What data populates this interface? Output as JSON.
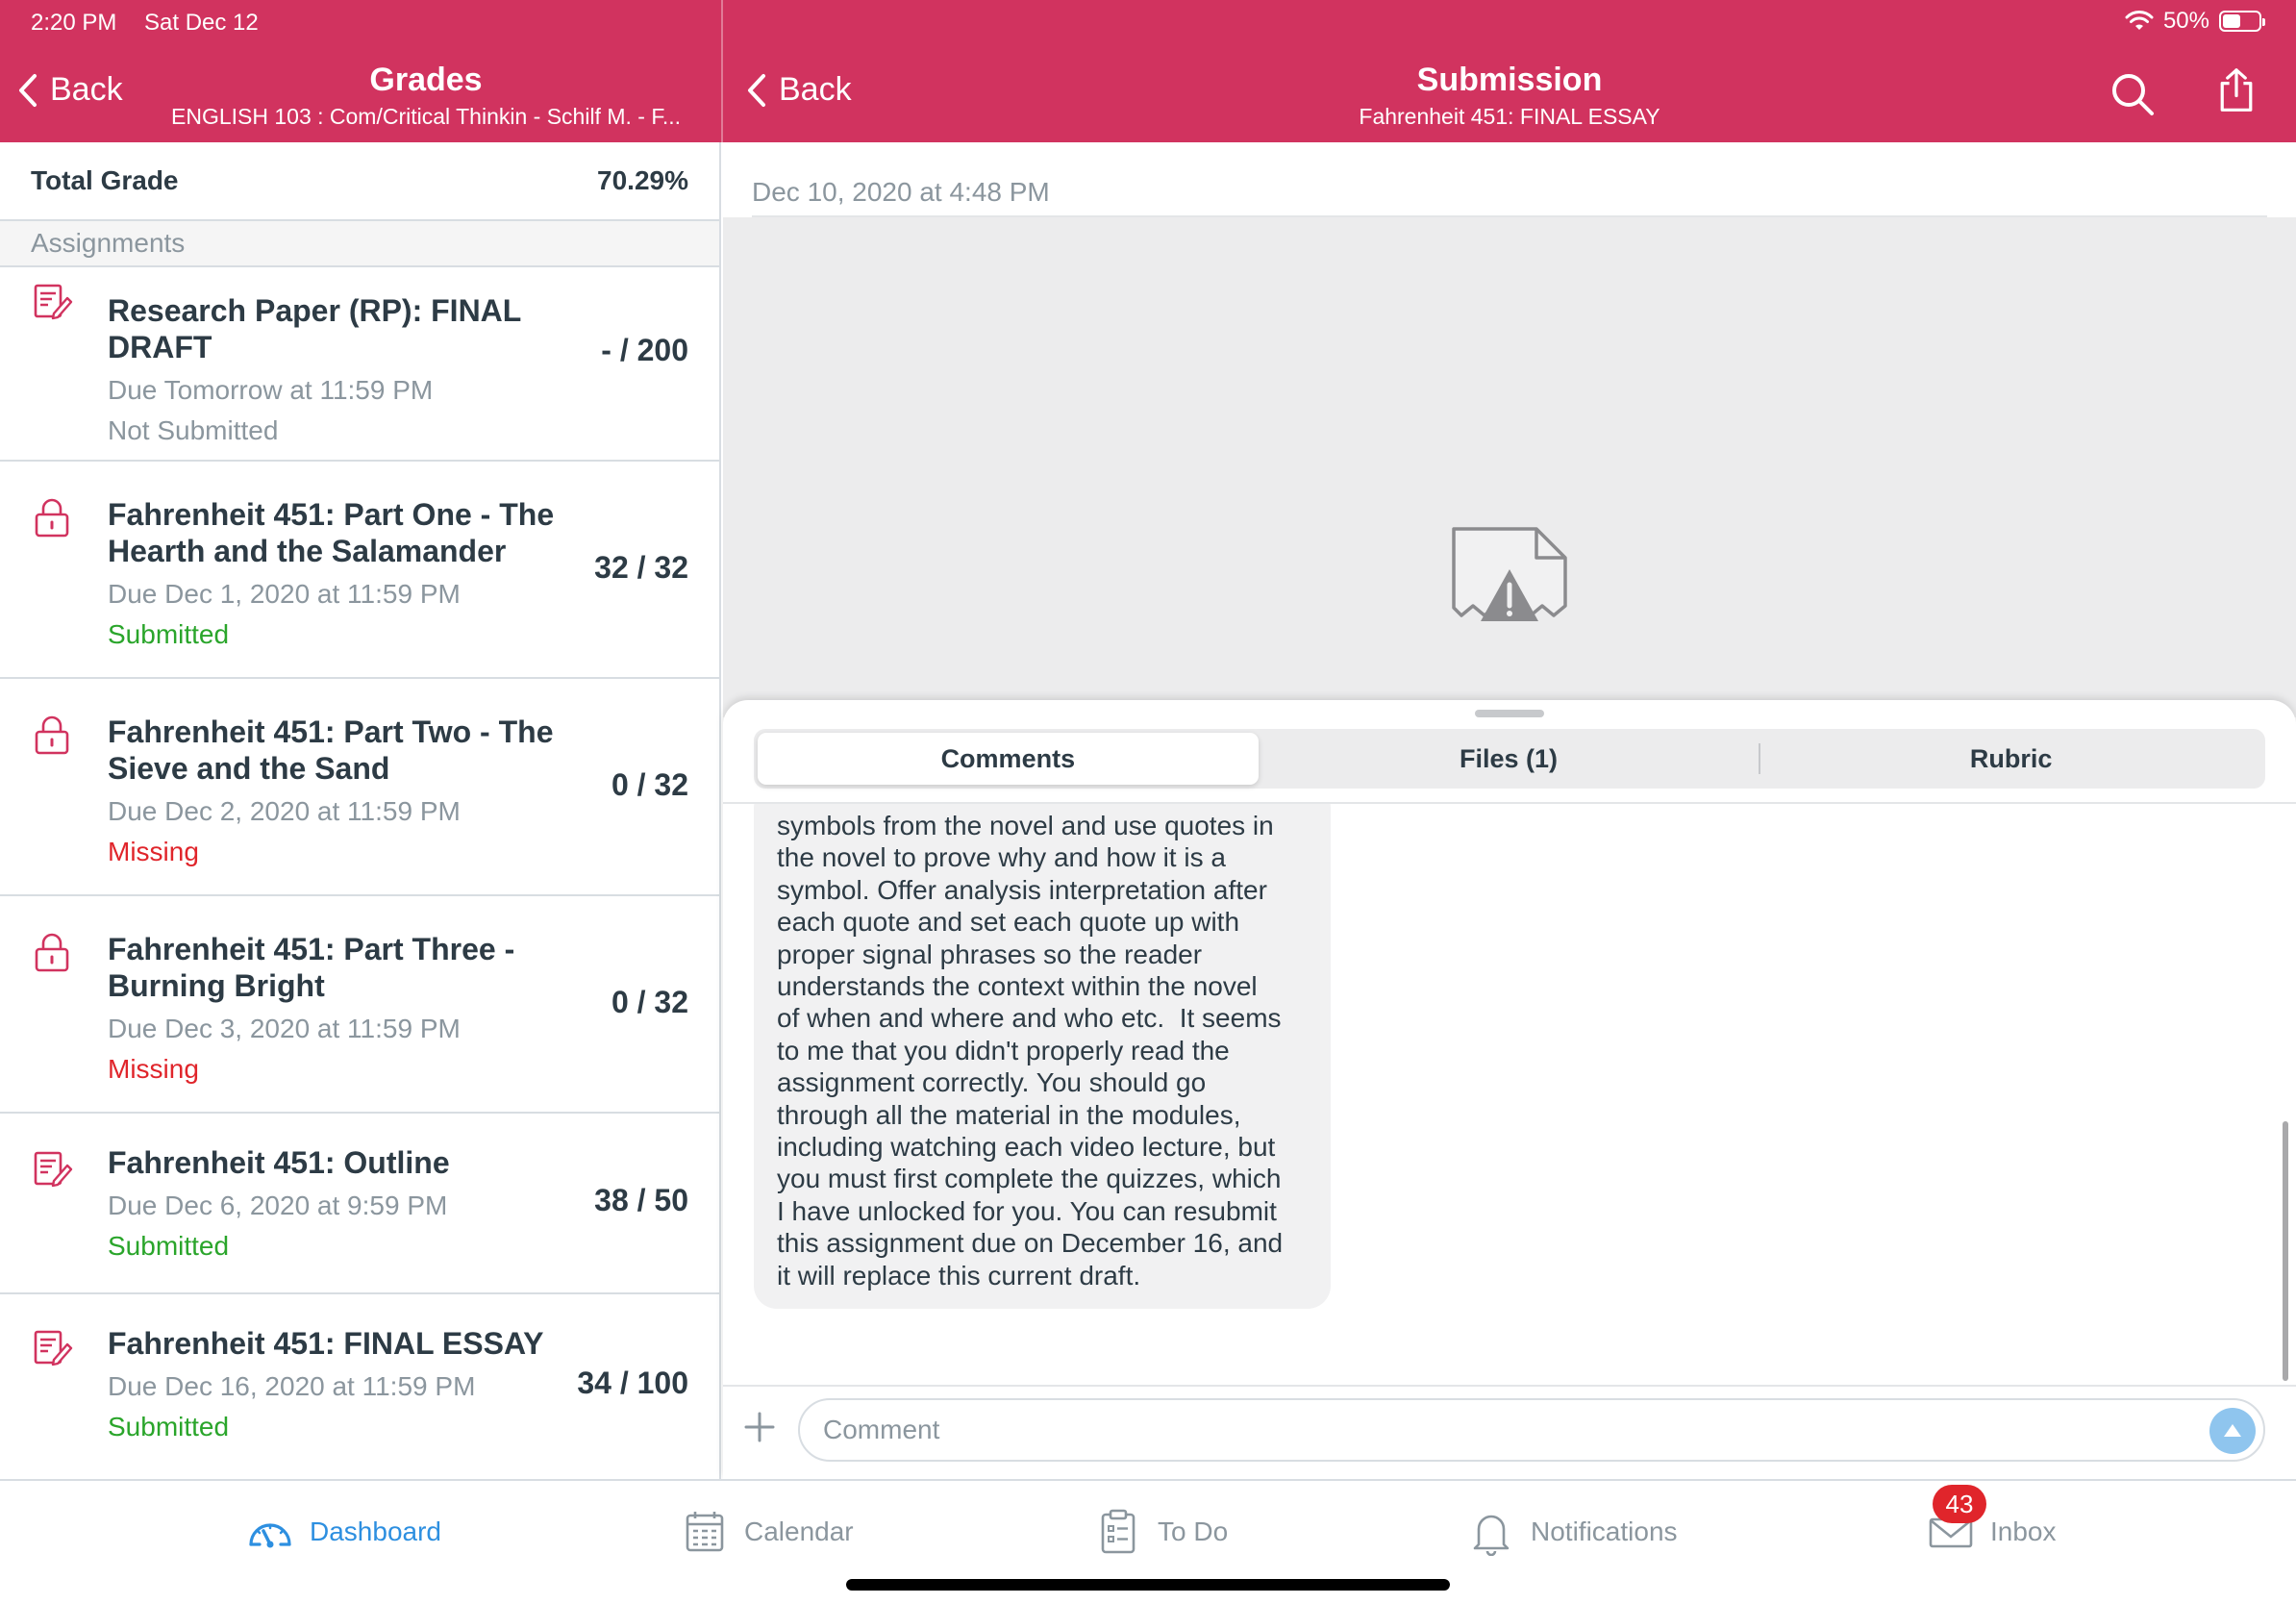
{
  "status": {
    "time": "2:20 PM",
    "date": "Sat Dec 12",
    "battery": "50%",
    "battery_level": 0.5
  },
  "left_header": {
    "back_label": "Back",
    "title": "Grades",
    "subtitle": "ENGLISH 103 : Com/Critical Thinkin - Schilf M. - F..."
  },
  "right_header": {
    "back_label": "Back",
    "title": "Submission",
    "subtitle": "Fahrenheit 451: FINAL ESSAY"
  },
  "grades": {
    "total_label": "Total Grade",
    "total_value": "70.29%",
    "section_label": "Assignments",
    "items": [
      {
        "name": "Research Paper (RP): FINAL DRAFT",
        "due": "Due Tomorrow at 11:59 PM",
        "status": "Not Submitted",
        "score": "- / 200",
        "icon": "assignment-icon",
        "status_color": "#8b969e"
      },
      {
        "name": "Fahrenheit 451: Part One - The Hearth and the Salamander",
        "due": "Due Dec 1, 2020 at 11:59 PM",
        "status": "Submitted",
        "score": "32 / 32",
        "icon": "lock-icon",
        "status_color": "#2aa52b"
      },
      {
        "name": "Fahrenheit 451: Part Two - The Sieve and the Sand",
        "due": "Due Dec 2, 2020 at 11:59 PM",
        "status": "Missing",
        "score": "0 / 32",
        "icon": "lock-icon",
        "status_color": "#e0252b"
      },
      {
        "name": "Fahrenheit 451: Part Three - Burning Bright",
        "due": "Due Dec 3, 2020 at 11:59 PM",
        "status": "Missing",
        "score": "0 / 32",
        "icon": "lock-icon",
        "status_color": "#e0252b"
      },
      {
        "name": "Fahrenheit 451: Outline",
        "due": "Due Dec 6, 2020 at 9:59 PM",
        "status": "Submitted",
        "score": "38 / 50",
        "icon": "assignment-icon",
        "status_color": "#2aa52b"
      },
      {
        "name": "Fahrenheit 451: FINAL ESSAY",
        "due": "Due Dec 16, 2020 at 11:59 PM",
        "status": "Submitted",
        "score": "34 / 100",
        "icon": "assignment-icon",
        "status_color": "#2aa52b"
      }
    ]
  },
  "submission": {
    "date": "Dec 10, 2020 at 4:48 PM",
    "tabs": [
      {
        "label": "Comments",
        "active": true
      },
      {
        "label": "Files (1)",
        "active": false
      },
      {
        "label": "Rubric",
        "active": false
      }
    ],
    "comment_text": "symbols from the novel and use quotes in\nthe novel to prove why and how it is a\nsymbol. Offer analysis interpretation after\neach quote and set each quote up with\nproper signal phrases so the reader\nunderstands the context within the novel\nof when and where and who etc.  It seems\nto me that you didn't properly read the\nassignment correctly. You should go\nthrough all the material in the modules,\nincluding watching each video lecture, but\nyou must first complete the quizzes, which\nI have unlocked for you. You can resubmit\nthis assignment due on December 16, and\nit will replace this current draft.",
    "comment_placeholder": "Comment"
  },
  "tabbar": {
    "items": [
      {
        "label": "Dashboard",
        "icon": "dashboard-icon",
        "active": true
      },
      {
        "label": "Calendar",
        "icon": "calendar-icon",
        "active": false
      },
      {
        "label": "To Do",
        "icon": "todo-icon",
        "active": false
      },
      {
        "label": "Notifications",
        "icon": "bell-icon",
        "active": false
      },
      {
        "label": "Inbox",
        "icon": "mail-icon",
        "active": false
      }
    ],
    "inbox_badge": "43"
  },
  "colors": {
    "brand": "#d1335f",
    "active_tab": "#2d8fe0",
    "submitted": "#2aa52b",
    "missing": "#e0252b"
  }
}
